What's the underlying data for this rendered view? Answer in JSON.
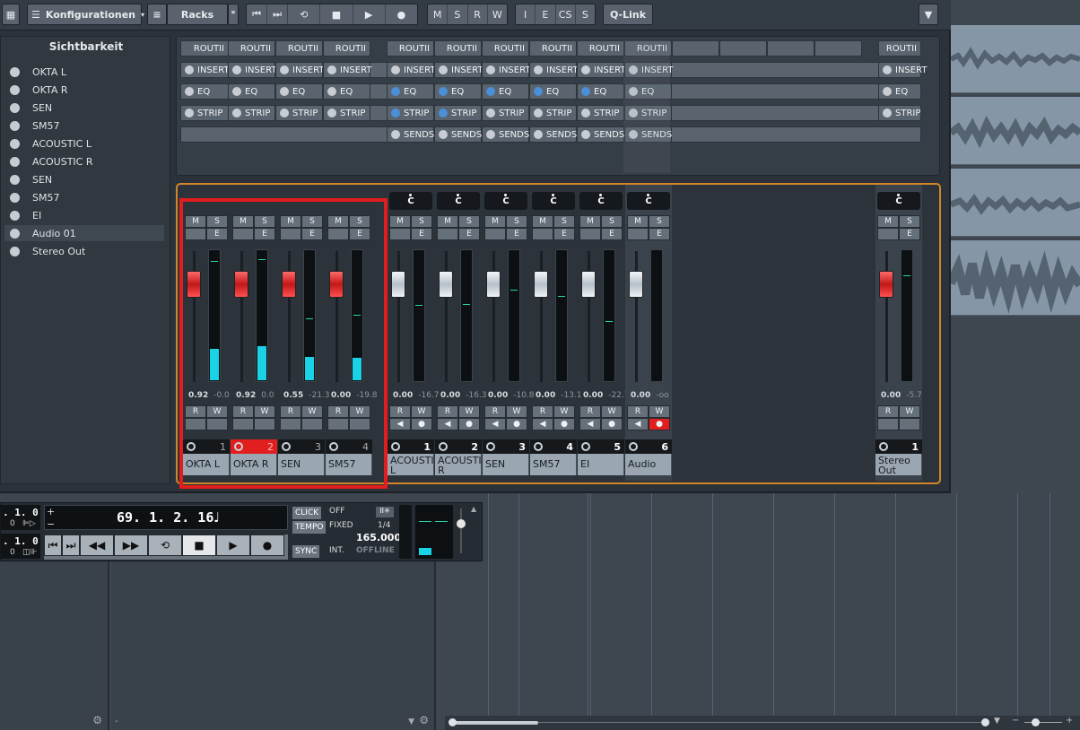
{
  "toolbar": {
    "configurations_label": "Konfigurationen",
    "racks_label": "Racks",
    "msrw": [
      "M",
      "S",
      "R",
      "W"
    ],
    "iecss": [
      "I",
      "E",
      "CS",
      "S"
    ],
    "qlink_label": "Q-Link"
  },
  "visibility": {
    "title": "Sichtbarkeit",
    "items": [
      "OKTA L",
      "OKTA R",
      "SEN",
      "SM57",
      "ACOUSTIC L",
      "ACOUSTIC R",
      "SEN",
      "SM57",
      "EI",
      "Audio 01",
      "Stereo Out"
    ]
  },
  "racks": {
    "routing_label": "ROUTII",
    "insert_label": "INSERT",
    "eq_label": "EQ",
    "strip_label": "STRIP",
    "sends_label": "SENDS"
  },
  "channels": [
    {
      "name": "OKTA L",
      "number": "1",
      "volume": "0.92",
      "peak": "-0.0",
      "level": 0.24,
      "peak_pos": 0.92,
      "fader": 0.75,
      "cap": "red",
      "selected": false
    },
    {
      "name": "OKTA R",
      "number": "2",
      "volume": "0.92",
      "peak": "0.0",
      "level": 0.26,
      "peak_pos": 0.93,
      "fader": 0.75,
      "cap": "red",
      "selected": true
    },
    {
      "name": "SEN",
      "number": "3",
      "volume": "0.55",
      "peak": "-21.3",
      "level": 0.18,
      "peak_pos": 0.48,
      "fader": 0.75,
      "cap": "red",
      "selected": false
    },
    {
      "name": "SM57",
      "number": "4",
      "volume": "0.00",
      "peak": "-19.8",
      "level": 0.17,
      "peak_pos": 0.51,
      "fader": 0.75,
      "cap": "red",
      "selected": false
    },
    {
      "name": "ACOUSTIC L",
      "number": "1",
      "volume": "0.00",
      "peak": "-16.7",
      "level": 0,
      "peak_pos": 0.58,
      "fader": 0.75,
      "cap": "white",
      "selected": false
    },
    {
      "name": "ACOUSTIC R",
      "number": "2",
      "volume": "0.00",
      "peak": "-16.3",
      "level": 0,
      "peak_pos": 0.59,
      "fader": 0.75,
      "cap": "white",
      "selected": false
    },
    {
      "name": "SEN",
      "number": "3",
      "volume": "0.00",
      "peak": "-10.8",
      "level": 0,
      "peak_pos": 0.7,
      "fader": 0.75,
      "cap": "white",
      "selected": false
    },
    {
      "name": "SM57",
      "number": "4",
      "volume": "0.00",
      "peak": "-13.1",
      "level": 0,
      "peak_pos": 0.65,
      "fader": 0.75,
      "cap": "white",
      "selected": false
    },
    {
      "name": "EI",
      "number": "5",
      "volume": "0.00",
      "peak": "-22.7",
      "level": 0,
      "peak_pos": 0.46,
      "fader": 0.75,
      "cap": "white",
      "selected": false
    },
    {
      "name": "Audio 01",
      "number": "6",
      "volume": "0.00",
      "peak": "-oo",
      "level": 0,
      "peak_pos": 0,
      "fader": 0.75,
      "cap": "white",
      "selected": false
    }
  ],
  "stereo_out": {
    "name": "Stereo Out",
    "number": "1",
    "volume": "0.00",
    "peak": "-5.7",
    "level": 0,
    "peak_pos": 0.81,
    "fader": 0.75
  },
  "strip_buttons": {
    "m": "M",
    "s": "S",
    "e": "E",
    "r": "R",
    "w": "W",
    "pan": "C"
  },
  "transport": {
    "position": "69. 1. 2. 16",
    "left_pos": ". 1. 0",
    "left_sub": "0",
    "right_pos": ". 1. 0",
    "right_sub": "0",
    "click_label": "CLICK",
    "click_value": "OFF",
    "tempo_label": "TEMPO",
    "tempo_mode": "FIXED",
    "signature": "1/4",
    "tempo_value": "165.000",
    "sync_label": "SYNC",
    "sync_mode": "INT.",
    "sync_status": "OFFLINE"
  }
}
